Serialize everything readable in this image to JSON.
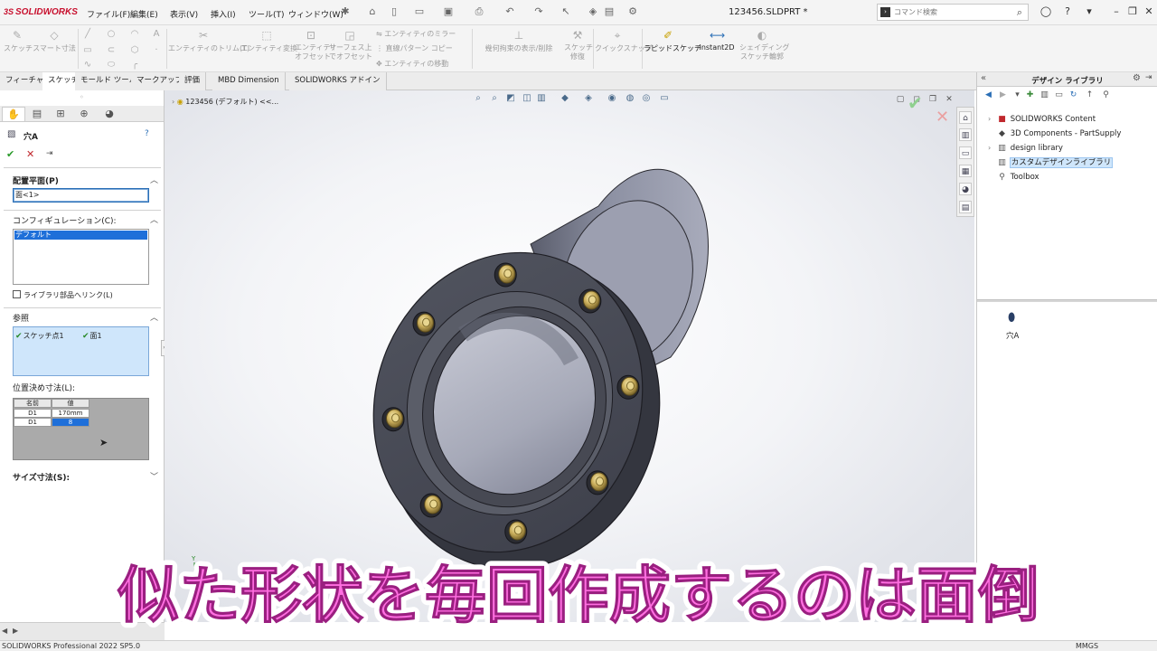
{
  "app": {
    "logo_text": "SOLIDWORKS",
    "logo_mark": "3S",
    "document_title": "123456.SLDPRT *",
    "search_placeholder": "コマンド検索"
  },
  "menu": [
    "ファイル(F)",
    "編集(E)",
    "表示(V)",
    "挿入(I)",
    "ツール(T)",
    "ウィンドウ(W)"
  ],
  "command_manager": {
    "sketch": "スケッチ",
    "smart_dimension": "スマート寸法",
    "trim_entities": "エンティティのトリム(T)",
    "convert_entities": "エンティティ変換",
    "offset_entities_1": "エンティティ",
    "offset_entities_2": "オフセット",
    "offset_surface_1": "サーフェス上",
    "offset_surface_2": "でオフセット",
    "mirror_entities": "エンティティのミラー",
    "linear_pattern": "直線パターン コピー",
    "move_entities": "エンティティの移動",
    "display_relations": "幾何拘束の表示/削除",
    "repair_sketch_1": "スケッチ",
    "repair_sketch_2": "修復",
    "quick_snaps": "クイックスナップ",
    "rapid_sketch": "ラピッドスケッチ",
    "instant2d": "Instant2D",
    "shaded_contours_1": "シェイディング",
    "shaded_contours_2": "スケッチ輪郭"
  },
  "tabs": [
    {
      "label": "フィーチャー",
      "active": false
    },
    {
      "label": "スケッチ",
      "active": true
    },
    {
      "label": "モールド ツール",
      "active": false
    },
    {
      "label": "マークアップ",
      "active": false
    },
    {
      "label": "評価",
      "active": false
    },
    {
      "label": "MBD Dimension",
      "active": false
    },
    {
      "label": "SOLIDWORKS アドイン",
      "active": false
    }
  ],
  "property_manager": {
    "feature_name": "穴A",
    "placement_plane_label": "配置平面(P)",
    "placement_plane_value": "面<1>",
    "configuration_label": "コンフィギュレーション(C):",
    "configuration_selected": "デフォルト",
    "link_to_library_label": "ライブラリ部品へリンク(L)",
    "references_label": "参照",
    "references": [
      "スケッチ点1",
      "面1"
    ],
    "location_dims_label": "位置決め寸法(L):",
    "dim_table": {
      "headers": [
        "名前",
        "値"
      ],
      "rows": [
        [
          "D1",
          "170mm"
        ],
        [
          "D1",
          "8"
        ]
      ]
    },
    "size_dims_label": "サイズ寸法(S):"
  },
  "viewport": {
    "tree_root": "123456 (デフォルト) <<..."
  },
  "design_library": {
    "title": "デザイン ライブラリ",
    "items": [
      {
        "label": "SOLIDWORKS Content",
        "icon": "red-cube-icon",
        "expandable": true
      },
      {
        "label": "3D Components - PartSupply",
        "icon": "part-icon",
        "expandable": false
      },
      {
        "label": "design library",
        "icon": "library-icon",
        "expandable": true
      },
      {
        "label": "カスタムデザインライブラリ",
        "icon": "library-icon",
        "expandable": false,
        "selected": true
      },
      {
        "label": "Toolbox",
        "icon": "toolbox-icon",
        "expandable": false
      }
    ],
    "preview_label": "穴A"
  },
  "status": {
    "product": "SOLIDWORKS Professional 2022 SP5.0",
    "units": "MMGS"
  },
  "caption": "似た形状を毎回作成するのは面倒",
  "colors": {
    "caption_fill": "#ff6ee0",
    "caption_stroke": "#ffffff",
    "selection_blue": "#1e6fd9",
    "flange_dark": "#3c3e4a",
    "bolt_gold": "#c9ad5a"
  }
}
